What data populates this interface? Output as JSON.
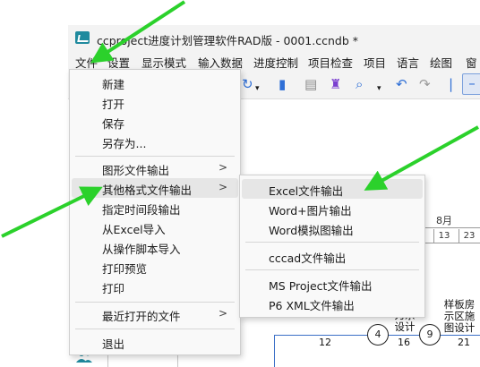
{
  "window": {
    "title": "ccproject进度计划管理软件RAD版 - 0001.ccndb *"
  },
  "menubar": {
    "items": [
      "文件",
      "设置",
      "显示模式",
      "输入数据",
      "进度控制",
      "项目检查",
      "项目",
      "语言",
      "绘图",
      "窗"
    ]
  },
  "file_menu": {
    "items": [
      {
        "label": "新建"
      },
      {
        "label": "打开"
      },
      {
        "label": "保存"
      },
      {
        "label": "另存为..."
      },
      {
        "label": "图形文件输出",
        "submenu": true
      },
      {
        "label": "其他格式文件输出",
        "submenu": true,
        "highlighted": true
      },
      {
        "label": "指定时间段输出"
      },
      {
        "label": "从Excel导入"
      },
      {
        "label": "从操作脚本导入"
      },
      {
        "label": "打印预览"
      },
      {
        "label": "打印"
      },
      {
        "label": "最近打开的文件",
        "submenu": true
      },
      {
        "label": "退出"
      }
    ]
  },
  "other_format_submenu": {
    "items": [
      {
        "label": "Excel文件输出",
        "highlighted": true
      },
      {
        "label": "Word+图片输出"
      },
      {
        "label": "Word模拟图输出"
      },
      {
        "label": "cccad文件输出"
      },
      {
        "label": "MS Project文件输出"
      },
      {
        "label": "P6 XML文件输出"
      }
    ]
  },
  "gantt": {
    "month": "8月",
    "days": [
      "13",
      "23"
    ],
    "task_labels": [
      "刀杀\n设计",
      "样板房\n示区施\n图设计"
    ],
    "nodes": [
      "4",
      "9"
    ],
    "durations": [
      "12",
      "16",
      "21"
    ]
  },
  "colors": {
    "arrow": "#2bd12b",
    "link": "#3b6fc7",
    "highlight": "#e6e6e6"
  }
}
